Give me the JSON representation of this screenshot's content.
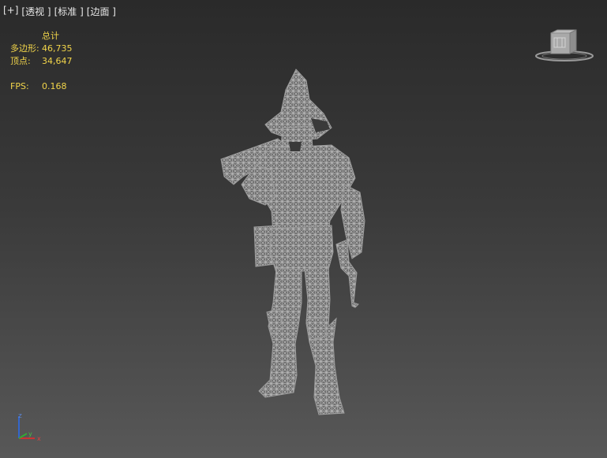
{
  "viewport": {
    "labels": [
      "[+]",
      "[透视 ]",
      "[标准 ]",
      "[边面 ]"
    ]
  },
  "stats": {
    "header": "总计",
    "polys_label": "多边形:",
    "polys_value": "46,735",
    "verts_label": "顶点:",
    "verts_value": "34,647",
    "fps_label": "FPS:",
    "fps_value": "0.168"
  },
  "viewcube": {
    "face_icon": "viewcube-icon"
  },
  "axis_gizmo": {
    "z": "z",
    "y": "y",
    "x": "x",
    "colors": {
      "x": "#cc3333",
      "y": "#33aa33",
      "z": "#3366cc"
    }
  },
  "model": {
    "icon": "wireframe-character-icon",
    "wire_color": "#a8a8a8"
  }
}
